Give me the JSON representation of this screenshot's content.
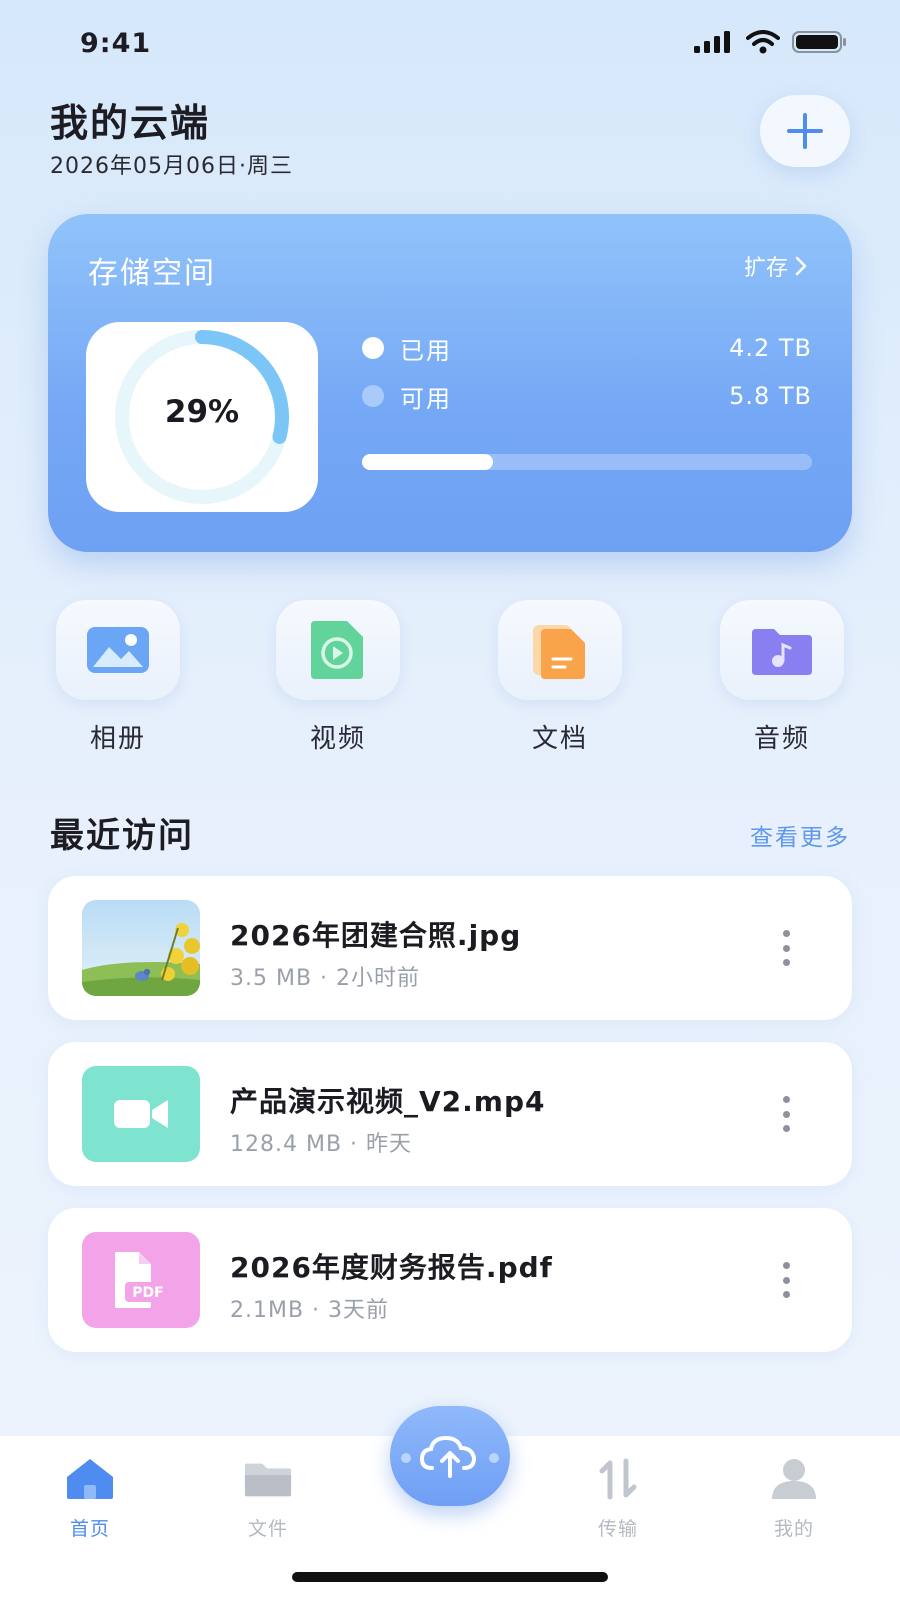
{
  "status_bar": {
    "time": "9:41"
  },
  "header": {
    "title": "我的云端",
    "date": "2026年05月06日·周三"
  },
  "storage": {
    "title": "存储空间",
    "expand_label": "扩存",
    "used_percent_label": "29%",
    "used_fraction": 0.29,
    "used_label": "已用",
    "used_value": "4.2 TB",
    "free_label": "可用",
    "free_value": "5.8 TB",
    "colors": {
      "ring": "#7cc5f7",
      "ring_track": "#e6f6fb",
      "used_dot": "#ffffff",
      "free_dot": "#a9cbfa"
    }
  },
  "categories": [
    {
      "label": "相册",
      "icon": "photo-album-icon",
      "color": "#6aa6f5"
    },
    {
      "label": "视频",
      "icon": "video-icon",
      "color": "#62d39a"
    },
    {
      "label": "文档",
      "icon": "document-icon",
      "color": "#f9a34a"
    },
    {
      "label": "音频",
      "icon": "audio-icon",
      "color": "#8a7ff0"
    }
  ],
  "recent": {
    "title": "最近访问",
    "more_label": "查看更多",
    "files": [
      {
        "name": "2026年团建合照.jpg",
        "meta": "3.5 MB · 2小时前",
        "icon": "photo-thumbnail"
      },
      {
        "name": "产品演示视频_V2.mp4",
        "meta": "128.4 MB · 昨天",
        "icon": "video-camera-icon",
        "color": "#7ee3cf"
      },
      {
        "name": "2026年度财务报告.pdf",
        "meta": "2.1MB · 3天前",
        "icon": "pdf-icon",
        "color": "#f3a3e8",
        "badge": "PDF"
      }
    ]
  },
  "nav": {
    "items": [
      {
        "label": "首页",
        "icon": "home-icon",
        "active": true
      },
      {
        "label": "文件",
        "icon": "folder-icon",
        "active": false
      },
      {
        "label": "传输",
        "icon": "transfer-icon",
        "active": false
      },
      {
        "label": "我的",
        "icon": "profile-icon",
        "active": false
      }
    ],
    "fab_icon": "cloud-upload-icon"
  },
  "accent_color": "#4e8cf0"
}
